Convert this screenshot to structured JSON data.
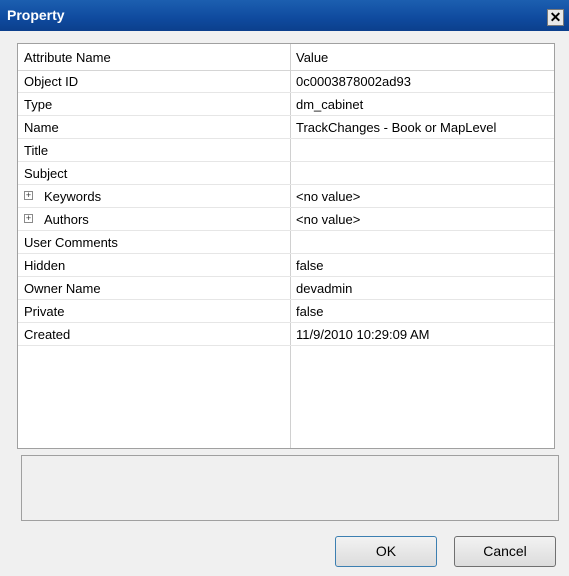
{
  "window": {
    "title": "Property",
    "close_glyph": "✕",
    "close_icon": "close-icon"
  },
  "grid": {
    "headers": [
      "Attribute Name",
      "Value"
    ],
    "rows": [
      {
        "name": "Object ID",
        "value": "0c0003878002ad93"
      },
      {
        "name": "Type",
        "value": "dm_cabinet"
      },
      {
        "name": "Name",
        "value": "TrackChanges - Book or MapLevel"
      },
      {
        "name": "Title",
        "value": ""
      },
      {
        "name": "Subject",
        "value": ""
      },
      {
        "name": "Keywords",
        "value": "<no value>",
        "expandable": true
      },
      {
        "name": "Authors",
        "value": "<no value>",
        "expandable": true
      },
      {
        "name": "User Comments",
        "value": ""
      },
      {
        "name": "Hidden",
        "value": "false"
      },
      {
        "name": "Owner Name",
        "value": "devadmin"
      },
      {
        "name": "Private",
        "value": "false"
      },
      {
        "name": "Created",
        "value": "11/9/2010 10:29:09 AM"
      }
    ],
    "expand_glyph": "+"
  },
  "buttons": {
    "ok": "OK",
    "cancel": "Cancel"
  },
  "colors": {
    "titlebar": "#0f4a9e",
    "background": "#f0f0f0"
  }
}
